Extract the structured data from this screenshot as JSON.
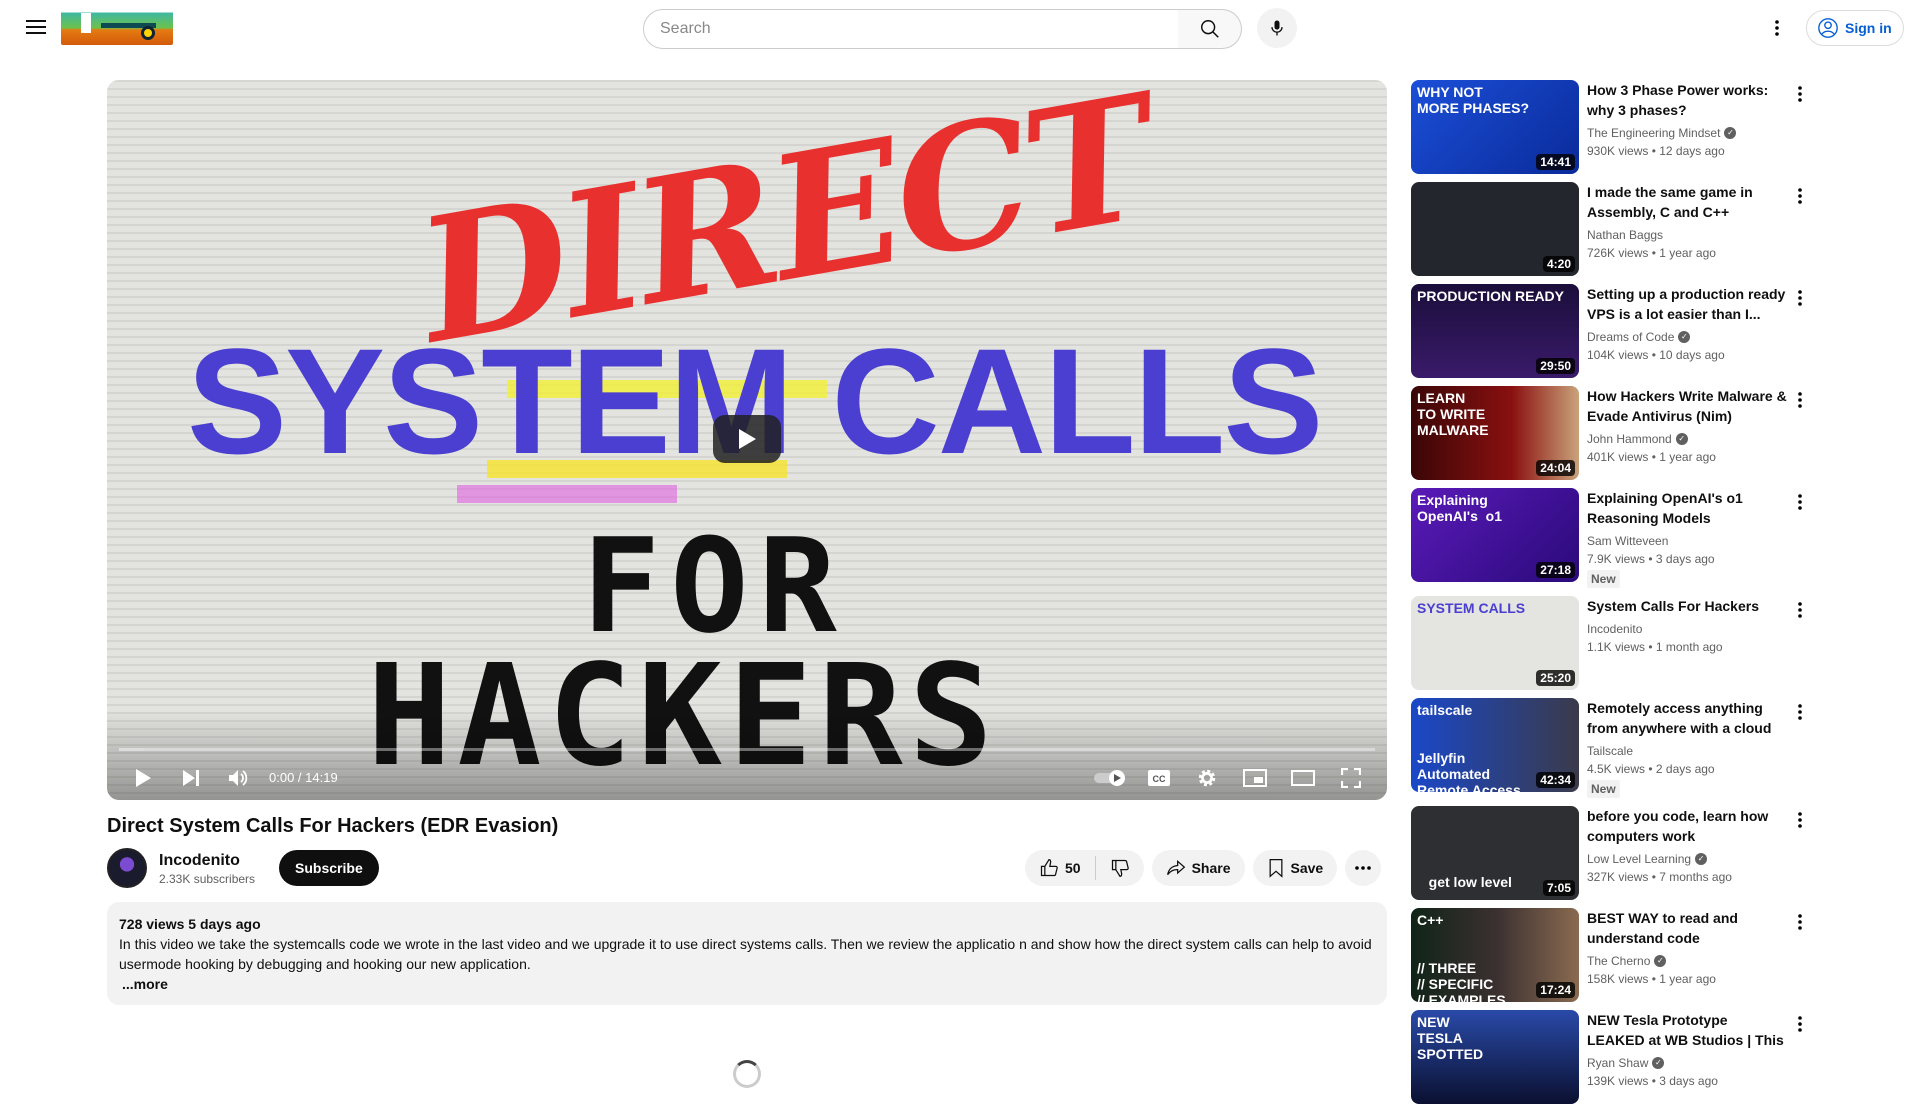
{
  "header": {
    "search_placeholder": "Search",
    "sign_in": "Sign in"
  },
  "player": {
    "thumb_text": {
      "line1": "DIRECT",
      "line2": "SYSTEM CALLS",
      "line3": "FOR",
      "line4": "HACKERS"
    },
    "time": "0:00 / 14:19",
    "progress_percent": 0
  },
  "video": {
    "title": "Direct System Calls For Hackers (EDR Evasion)",
    "channel": "Incodenito",
    "subscribers": "2.33K subscribers",
    "subscribe": "Subscribe",
    "likes": "50",
    "share": "Share",
    "save": "Save"
  },
  "description": {
    "meta": "728 views  5 days ago",
    "text": "In this video we take the systemcalls code we wrote in the last video and we upgrade it to use direct systems calls. Then we review the applicatio n and show how the direct system calls can help to avoid usermode hooking by debugging and hooking our new application.",
    "more": "...more"
  },
  "colors": {
    "accent": "#065fd4",
    "subscribe_bg": "#0f0f0f",
    "thumb_red": "#e8312f",
    "thumb_blue": "#4a3fd0"
  },
  "recommendations": [
    {
      "title": "How 3 Phase Power works: why 3 phases?",
      "channel": "The Engineering Mindset",
      "verified": true,
      "views": "930K views • 12 days ago",
      "duration": "14:41",
      "thumb_text": "WHY NOT\nMORE PHASES?",
      "bg": "linear-gradient(135deg,#1b4fd8,#0a2a9a)"
    },
    {
      "title": "I made the same game in Assembly, C and C++",
      "channel": "Nathan Baggs",
      "verified": false,
      "views": "726K views • 1 year ago",
      "duration": "4:20",
      "thumb_text": "",
      "bg": "#23262d"
    },
    {
      "title": "Setting up a production ready VPS is a lot easier than I...",
      "channel": "Dreams of Code",
      "verified": true,
      "views": "104K views • 10 days ago",
      "duration": "29:50",
      "thumb_text": "PRODUCTION READY",
      "bg": "linear-gradient(#1a0e3a,#3a1a6a)"
    },
    {
      "title": "How Hackers Write Malware & Evade Antivirus (Nim)",
      "channel": "John Hammond",
      "verified": true,
      "views": "401K views • 1 year ago",
      "duration": "24:04",
      "thumb_text": "LEARN\nTO WRITE\nMALWARE",
      "bg": "linear-gradient(90deg,#3a0606,#8a1010 60%,#c9a27a)"
    },
    {
      "title": "Explaining OpenAI's o1 Reasoning Models",
      "channel": "Sam Witteveen",
      "verified": false,
      "views": "7.9K views • 3 days ago",
      "badge": "New",
      "duration": "27:18",
      "thumb_text": "Explaining\nOpenAI's  o1",
      "bg": "linear-gradient(135deg,#5a1ab8,#2a0a7a)"
    },
    {
      "title": "System Calls For Hackers",
      "channel": "Incodenito",
      "verified": false,
      "views": "1.1K views • 1 month ago",
      "duration": "25:20",
      "thumb_text": "SYSTEM CALLS",
      "bg": "#e4e4e1"
    },
    {
      "title": "Remotely access anything from anywhere with a cloud VPS an...",
      "channel": "Tailscale",
      "verified": false,
      "views": "4.5K views • 2 days ago",
      "badge": "New",
      "duration": "42:34",
      "thumb_text": "tailscale\n\n\nJellyfin\nAutomated\nRemote Access",
      "bg": "linear-gradient(90deg,#1a48c8,#3a3a4a)"
    },
    {
      "title": "before you code, learn how computers work",
      "channel": "Low Level Learning",
      "verified": true,
      "views": "327K views • 7 months ago",
      "duration": "7:05",
      "thumb_text": "\n\n\n\n   get low level",
      "bg": "#2e2f33"
    },
    {
      "title": "BEST WAY to read and understand code",
      "channel": "The Cherno",
      "verified": true,
      "views": "158K views • 1 year ago",
      "duration": "17:24",
      "thumb_text": "C++\n\n\n// THREE\n// SPECIFIC\n// EXAMPLES",
      "bg": "linear-gradient(90deg,#102418,#3a3030 50%,#8a6a50)"
    },
    {
      "title": "NEW Tesla Prototype LEAKED at WB Studios | This Design Is...",
      "channel": "Ryan Shaw",
      "verified": true,
      "views": "139K views • 3 days ago",
      "duration": "",
      "thumb_text": "NEW\nTESLA\nSPOTTED",
      "bg": "linear-gradient(#2a4aa8,#0a1030)"
    }
  ]
}
